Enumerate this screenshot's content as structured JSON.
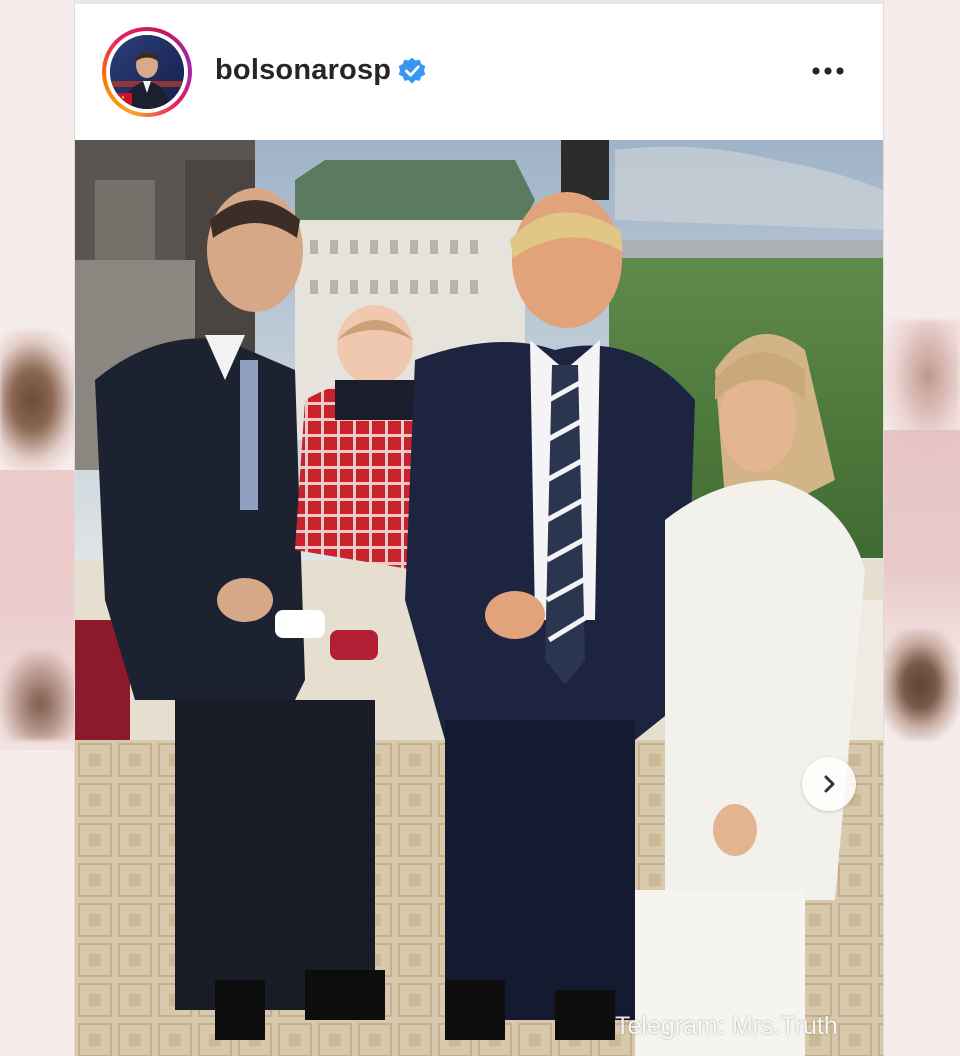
{
  "profile": {
    "username": "bolsonarosp",
    "verified": true
  },
  "photo": {
    "watermark": "Telegram: Mrs.Truth"
  },
  "icons": {
    "verified": "verified-badge-icon",
    "more": "more-options-icon",
    "next": "chevron-right-icon"
  },
  "colors": {
    "verified_blue": "#3897f0",
    "username_text": "#262626",
    "story_ring": [
      "#f9a825",
      "#e91e63",
      "#9c27b0"
    ]
  }
}
